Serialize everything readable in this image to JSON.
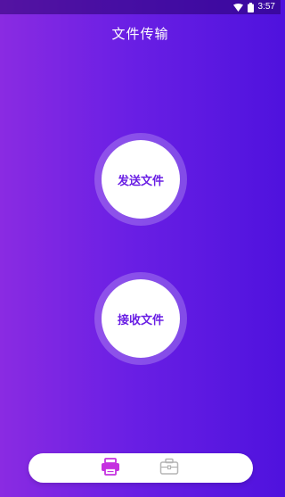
{
  "status_bar": {
    "time": "3:57",
    "wifi_icon": "wifi-icon",
    "battery_icon": "battery-icon"
  },
  "header": {
    "title": "文件传输"
  },
  "actions": {
    "send_label": "发送文件",
    "receive_label": "接收文件"
  },
  "bottom_nav": {
    "items": [
      {
        "icon": "printer-icon",
        "active": true,
        "color": "#c531e0"
      },
      {
        "icon": "briefcase-icon",
        "active": false,
        "color": "#b5b5b5"
      }
    ]
  },
  "colors": {
    "gradient_start": "#8a2be2",
    "gradient_end": "#4f12de",
    "accent_text": "#6a1fe4"
  }
}
